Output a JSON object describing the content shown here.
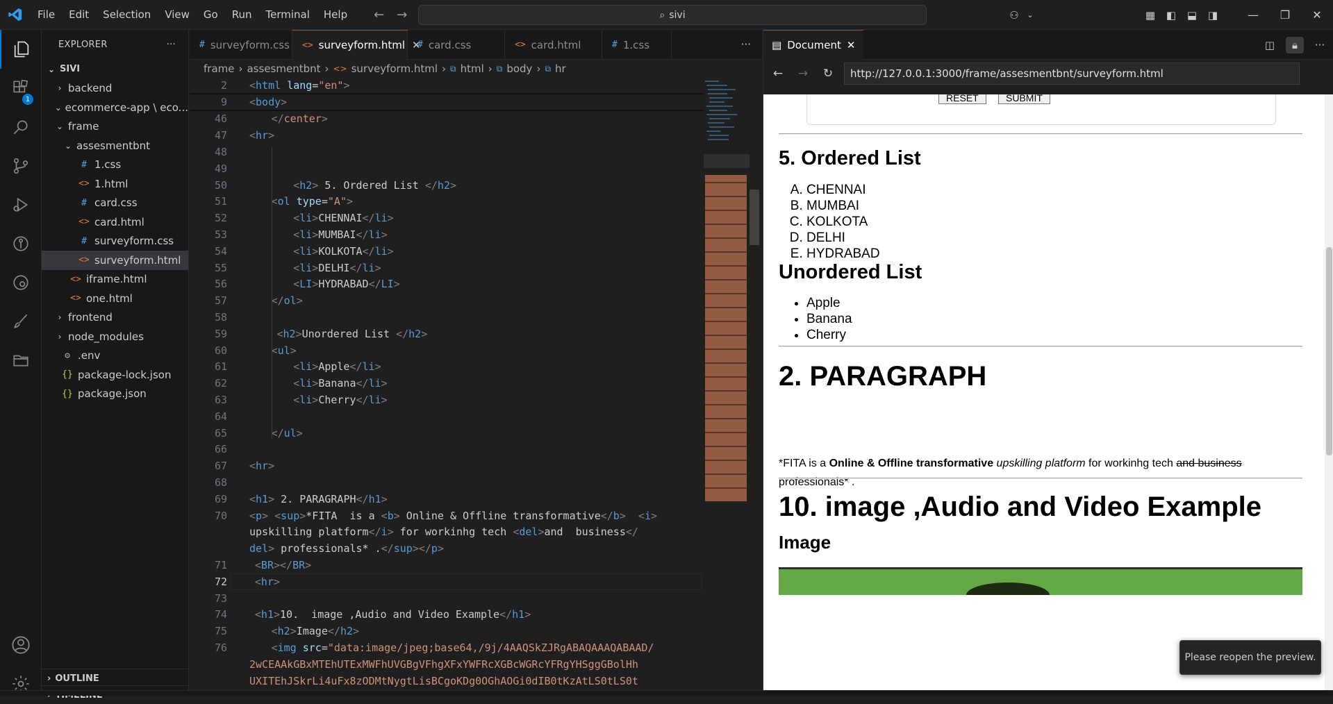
{
  "titlebar": {
    "menu": [
      "File",
      "Edit",
      "Selection",
      "View",
      "Go",
      "Run",
      "Terminal",
      "Help"
    ],
    "search_text": "sivi"
  },
  "activity": {
    "extensions_badge": "1"
  },
  "sidebar": {
    "title": "EXPLORER",
    "root": "SIVI",
    "items": [
      {
        "label": "backend",
        "type": "folder",
        "indent": 1,
        "open": false
      },
      {
        "label": "ecommerce-app \\ eco...",
        "type": "folder",
        "indent": 1,
        "open": true
      },
      {
        "label": "frame",
        "type": "folder",
        "indent": 1,
        "open": true
      },
      {
        "label": "assesmentbnt",
        "type": "folder",
        "indent": 2,
        "open": true
      },
      {
        "label": "1.css",
        "type": "css",
        "indent": 3
      },
      {
        "label": "1.html",
        "type": "html",
        "indent": 3
      },
      {
        "label": "card.css",
        "type": "css",
        "indent": 3
      },
      {
        "label": "card.html",
        "type": "html",
        "indent": 3
      },
      {
        "label": "surveyform.css",
        "type": "css",
        "indent": 3
      },
      {
        "label": "surveyform.html",
        "type": "html",
        "indent": 3,
        "selected": true
      },
      {
        "label": "iframe.html",
        "type": "html",
        "indent": 2
      },
      {
        "label": "one.html",
        "type": "html",
        "indent": 2
      },
      {
        "label": "frontend",
        "type": "folder",
        "indent": 1,
        "open": false
      },
      {
        "label": "node_modules",
        "type": "folder",
        "indent": 1,
        "open": false
      },
      {
        "label": ".env",
        "type": "env",
        "indent": 1
      },
      {
        "label": "package-lock.json",
        "type": "json",
        "indent": 1
      },
      {
        "label": "package.json",
        "type": "json",
        "indent": 1
      }
    ],
    "outline": "OUTLINE",
    "timeline": "TIMELINE"
  },
  "tabs": [
    {
      "label": "surveyform.css",
      "type": "css",
      "active": false
    },
    {
      "label": "surveyform.html",
      "type": "html",
      "active": true
    },
    {
      "label": "card.css",
      "type": "css",
      "active": false
    },
    {
      "label": "card.html",
      "type": "html",
      "active": false
    },
    {
      "label": "1.css",
      "type": "css",
      "active": false
    }
  ],
  "breadcrumb": [
    "frame",
    "assesmentbnt",
    "surveyform.html",
    "html",
    "body",
    "hr"
  ],
  "code_lines": [
    {
      "n": "2",
      "html": "<span class='br'>&lt;</span><span class='tg'>html</span> <span class='at'>lang</span>=<span class='st'>\"en\"</span><span class='br'>&gt;</span>",
      "indent": 0,
      "sticky": true
    },
    {
      "n": "9",
      "html": "<span class='br'>&lt;</span><span class='tg'>body</span><span class='br'>&gt;</span>",
      "indent": 0,
      "sticky": true
    },
    {
      "n": "46",
      "html": "<span class='br'>&lt;/</span><span class='st'>center</span><span class='br'>&gt;</span>",
      "indent": 4
    },
    {
      "n": "47",
      "html": "<span class='br'>&lt;</span><span class='tg'>hr</span><span class='br'>&gt;</span>",
      "indent": 0
    },
    {
      "n": "48",
      "html": "",
      "indent": 0
    },
    {
      "n": "49",
      "html": "",
      "indent": 0
    },
    {
      "n": "50",
      "html": "<span class='br'>&lt;</span><span class='tg'>h2</span><span class='br'>&gt;</span> 5. Ordered List <span class='br'>&lt;/</span><span class='tg'>h2</span><span class='br'>&gt;</span>",
      "indent": 8
    },
    {
      "n": "51",
      "html": "<span class='br'>&lt;</span><span class='tg'>ol</span> <span class='at'>type</span>=<span class='st'>\"A\"</span><span class='br'>&gt;</span>",
      "indent": 4
    },
    {
      "n": "52",
      "html": "<span class='br'>&lt;</span><span class='tg'>li</span><span class='br'>&gt;</span>CHENNAI<span class='br'>&lt;/</span><span class='tg'>li</span><span class='br'>&gt;</span>",
      "indent": 8
    },
    {
      "n": "53",
      "html": "<span class='br'>&lt;</span><span class='tg'>li</span><span class='br'>&gt;</span>MUMBAI<span class='br'>&lt;/</span><span class='tg'>li</span><span class='br'>&gt;</span>",
      "indent": 8
    },
    {
      "n": "54",
      "html": "<span class='br'>&lt;</span><span class='tg'>li</span><span class='br'>&gt;</span>KOLKOTA<span class='br'>&lt;/</span><span class='tg'>li</span><span class='br'>&gt;</span>",
      "indent": 8
    },
    {
      "n": "55",
      "html": "<span class='br'>&lt;</span><span class='tg'>li</span><span class='br'>&gt;</span>DELHI<span class='br'>&lt;/</span><span class='tg'>li</span><span class='br'>&gt;</span>",
      "indent": 8
    },
    {
      "n": "56",
      "html": "<span class='br'>&lt;</span><span class='tg'>LI</span><span class='br'>&gt;</span>HYDRABAD<span class='br'>&lt;/</span><span class='tg'>LI</span><span class='br'>&gt;</span>",
      "indent": 8
    },
    {
      "n": "57",
      "html": "<span class='br'>&lt;/</span><span class='tg'>ol</span><span class='br'>&gt;</span>",
      "indent": 4
    },
    {
      "n": "58",
      "html": "",
      "indent": 0
    },
    {
      "n": "59",
      "html": "<span class='br'>&lt;</span><span class='tg'>h2</span><span class='br'>&gt;</span>Unordered List <span class='br'>&lt;/</span><span class='tg'>h2</span><span class='br'>&gt;</span>",
      "indent": 5
    },
    {
      "n": "60",
      "html": "<span class='br'>&lt;</span><span class='tg'>ul</span><span class='br'>&gt;</span>",
      "indent": 4
    },
    {
      "n": "61",
      "html": "<span class='br'>&lt;</span><span class='tg'>li</span><span class='br'>&gt;</span>Apple<span class='br'>&lt;/</span><span class='tg'>li</span><span class='br'>&gt;</span>",
      "indent": 8
    },
    {
      "n": "62",
      "html": "<span class='br'>&lt;</span><span class='tg'>li</span><span class='br'>&gt;</span>Banana<span class='br'>&lt;/</span><span class='tg'>li</span><span class='br'>&gt;</span>",
      "indent": 8
    },
    {
      "n": "63",
      "html": "<span class='br'>&lt;</span><span class='tg'>li</span><span class='br'>&gt;</span>Cherry<span class='br'>&lt;/</span><span class='tg'>li</span><span class='br'>&gt;</span>",
      "indent": 8
    },
    {
      "n": "64",
      "html": "",
      "indent": 0
    },
    {
      "n": "65",
      "html": "<span class='br'>&lt;/</span><span class='tg'>ul</span><span class='br'>&gt;</span>",
      "indent": 4
    },
    {
      "n": "66",
      "html": "",
      "indent": 0
    },
    {
      "n": "67",
      "html": "<span class='br'>&lt;</span><span class='tg'>hr</span><span class='br'>&gt;</span>",
      "indent": 0
    },
    {
      "n": "68",
      "html": "",
      "indent": 0
    },
    {
      "n": "69",
      "html": "<span class='br'>&lt;</span><span class='tg'>h1</span><span class='br'>&gt;</span> 2. PARAGRAPH<span class='br'>&lt;/</span><span class='tg'>h1</span><span class='br'>&gt;</span>",
      "indent": 0
    },
    {
      "n": "70",
      "html": "<span class='br'>&lt;</span><span class='tg'>p</span><span class='br'>&gt;</span> <span class='br'>&lt;</span><span class='tg'>sup</span><span class='br'>&gt;</span>*FITA  is a <span class='br'>&lt;</span><span class='tg'>b</span><span class='br'>&gt;</span> Online &amp; Offline transformative<span class='br'>&lt;/</span><span class='tg'>b</span><span class='br'>&gt;</span>  <span class='br'>&lt;</span><span class='tg'>i</span><span class='br'>&gt;</span>",
      "indent": 0
    },
    {
      "n": "",
      "html": "upskilling platform<span class='br'>&lt;/</span><span class='tg'>i</span><span class='br'>&gt;</span> for workinhg tech <span class='br'>&lt;</span><span class='tg'>del</span><span class='br'>&gt;</span>and  business<span class='br'>&lt;/</span>",
      "indent": 0
    },
    {
      "n": "",
      "html": "<span class='tg'>del</span><span class='br'>&gt;</span> professionals* .<span class='br'>&lt;/</span><span class='tg'>sup</span><span class='br'>&gt;&lt;/</span><span class='tg'>p</span><span class='br'>&gt;</span>",
      "indent": 0
    },
    {
      "n": "71",
      "html": "<span class='br'>&lt;</span><span class='tg'>BR</span><span class='br'>&gt;&lt;/</span><span class='tg'>BR</span><span class='br'>&gt;</span>",
      "indent": 1
    },
    {
      "n": "72",
      "html": "<span class='br'>&lt;</span><span class='tg'>hr</span><span class='br'>&gt;</span>",
      "indent": 1,
      "current": true
    },
    {
      "n": "73",
      "html": "",
      "indent": 0
    },
    {
      "n": "74",
      "html": "<span class='br'>&lt;</span><span class='tg'>h1</span><span class='br'>&gt;</span>10.  image ,Audio and Video Example<span class='br'>&lt;/</span><span class='tg'>h1</span><span class='br'>&gt;</span>",
      "indent": 1
    },
    {
      "n": "75",
      "html": "<span class='br'>&lt;</span><span class='tg'>h2</span><span class='br'>&gt;</span>Image<span class='br'>&lt;/</span><span class='tg'>h2</span><span class='br'>&gt;</span>",
      "indent": 4
    },
    {
      "n": "76",
      "html": "<span class='br'>&lt;</span><span class='tg'>img</span> <span class='at'>src</span>=<span class='st'>\"data:image/jpeg;base64,/9j/4AAQSkZJRgABAQAAAQABAAD/</span>",
      "indent": 4
    },
    {
      "n": "",
      "html": "<span class='st'>2wCEAAkGBxMTEhUTExMWFhUVGBgVFhgXFxYWFRcXGBcWGRcYFRgYHSggGBolHh</span>",
      "indent": 0
    },
    {
      "n": "",
      "html": "<span class='st'>UXITEhJSkrLi4uFx8zODMtNygtLisBCgoKDg0OGhAOGi0dIB0tKzAtLS0tLS0t</span>",
      "indent": 0
    }
  ],
  "preview": {
    "tab_label": "Document",
    "url": "http://127.0.0.1:3000/frame/assesmentbnt/surveyform.html",
    "form_buttons": [
      "RESET",
      "SUBMIT"
    ],
    "ordered_heading": "5. Ordered List",
    "ordered_items": [
      "CHENNAI",
      "MUMBAI",
      "KOLKOTA",
      "DELHI",
      "HYDRABAD"
    ],
    "unordered_heading": "Unordered List",
    "unordered_items": [
      "Apple",
      "Banana",
      "Cherry"
    ],
    "paragraph_heading": "2. PARAGRAPH",
    "para": {
      "p1": "*FITA is a ",
      "bold": "Online & Offline transformative",
      "p2": " ",
      "italic": "upskilling platform",
      "p3": " for workinhg tech ",
      "del": "and business",
      "p4": "professionals* ."
    },
    "media_heading": "10. image ,Audio and Video Example",
    "image_heading": "Image"
  },
  "toast": "Please reopen the preview."
}
